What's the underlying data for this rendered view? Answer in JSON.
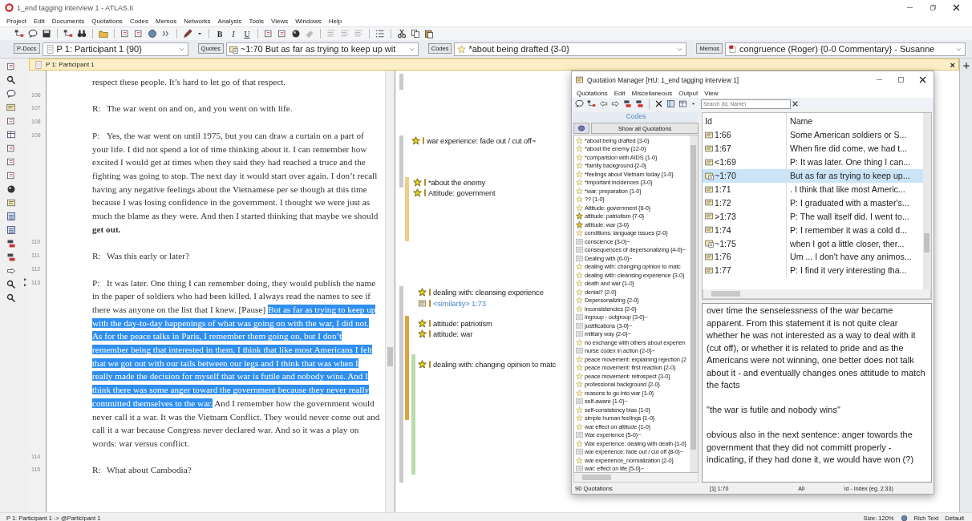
{
  "window": {
    "title": "1_end tagging interview 1 - ATLAS.ti"
  },
  "menu": [
    "Project",
    "Edit",
    "Documents",
    "Quotations",
    "Codes",
    "Memos",
    "Networks",
    "Analysis",
    "Tools",
    "Views",
    "Windows",
    "Help"
  ],
  "format_buttons": [
    "B",
    "I",
    "U"
  ],
  "selectors": [
    {
      "button": "P-Docs",
      "value": "P 1: Participant 1 {90}",
      "kind": "doc"
    },
    {
      "button": "Quotes",
      "value": "~1:70 But as far as trying to keep up wit",
      "kind": "quote"
    },
    {
      "button": "Codes",
      "value": "*about being drafted {3-0}",
      "kind": "code"
    },
    {
      "button": "Memos",
      "value": "congruence (Roger) {0-0 Commentary} - Susanne",
      "kind": "memo"
    }
  ],
  "document": {
    "title": "P 1: Participant 1",
    "close_label": "×",
    "paragraphs": [
      {
        "segments": [
          {
            "text": "respect these people. It’s hard to let go of that respect.",
            "selected": false
          }
        ]
      },
      {
        "number": "106"
      },
      {
        "number": "107",
        "speaker": "R:",
        "segments": [
          {
            "text": "The war went on and on, and you went on with life.",
            "selected": false
          }
        ]
      },
      {
        "number": "108"
      },
      {
        "number": "109",
        "speaker": "P:",
        "segments": [
          {
            "text": "Yes, the war went on until 1975, but you can draw a curtain on a part of your life. I did not spend a lot of time thinking about it. I can remember how excited I would get at times when they said they had reached a truce and the fighting was going to stop. The next day it would start over again. I don’t recall having any negative feelings about the Vietnamese per se though at this time because I was losing confidence in the government. I thought we were just as much the blame as they were. And then I started thinking that maybe we should **get out.**",
            "selected": false
          }
        ]
      },
      {
        "number": "110"
      },
      {
        "number": "111",
        "speaker": "R:",
        "segments": [
          {
            "text": "Was this early or later?",
            "selected": false
          }
        ]
      },
      {
        "number": "112"
      },
      {
        "number": "113",
        "speaker": "P:",
        "segments": [
          {
            "text": "It was later. One thing I can remember doing, they would publish the name in the paper of soldiers who had been killed. I always read the names to see if there was anyone on the list that I knew. [Pause] ",
            "selected": false
          },
          {
            "text": "But as far as trying to keep up with the day-to-day happenings of what was going on with the war, I did not. As for the peace talks in Paris, I remember them going on, but I don’t remember being that interested in them. I think that like most Americans I felt that we got out with our tails between our legs and I think that was when I really made the decision for myself that war is futile and nobody wins. And I think there was some anger toward the government because they never really committed themselves to the war.",
            "selected": true
          },
          {
            "text": " And I remember how the government would never call it a war. It was the Vietnam Conflict. They would never come out and call it a war because Congress never declared war. And so it was a play on words: war versus conflict.",
            "selected": false
          }
        ]
      },
      {
        "number": "114"
      },
      {
        "number": "115",
        "speaker": "R:",
        "segments": [
          {
            "text": "What about Cambodia?",
            "selected": false
          }
        ]
      }
    ]
  },
  "margin": {
    "bars": [
      {
        "color": "#c9c9ce"
      },
      {
        "color": "#c9c9ce"
      },
      {
        "color": "#f0cc88"
      },
      {
        "color": "#c9c9ce"
      },
      {
        "color": "#d9a441"
      },
      {
        "color": "#b9dcaa"
      }
    ],
    "codes": [
      {
        "label": "war experience: fade out / cut off~",
        "kind": "code"
      },
      {
        "label": "*about the enemy",
        "kind": "code"
      },
      {
        "label": "Attitude: government",
        "kind": "code"
      },
      {
        "label": "dealing with: cleansing experience",
        "kind": "code"
      },
      {
        "label": "<similartiy> 1:73",
        "kind": "link"
      },
      {
        "label": "attitude: patriotism",
        "kind": "code"
      },
      {
        "label": "attitude: war",
        "kind": "code"
      },
      {
        "label": "dealing with: changing opinion to matc",
        "kind": "code"
      }
    ]
  },
  "quotation_manager": {
    "title": "Quotation Manager [HU: 1_end tagging interview 1]",
    "menu": [
      "Quotations",
      "Edit",
      "Miscellaneous",
      "Output",
      "View"
    ],
    "search": {
      "placeholder": "Search (Id, Name)"
    },
    "codes_header": "Codes",
    "show_all_button": "Show all Quotations",
    "codes": [
      {
        "label": "*about being drafted {3-0}",
        "kind": "plain",
        "highlighted": false
      },
      {
        "label": "*about the enemy {12-0}",
        "kind": "plain",
        "highlighted": false
      },
      {
        "label": "*comparision with AIDS {1-0}",
        "kind": "plain",
        "highlighted": false
      },
      {
        "label": "*family background {2-0}",
        "kind": "plain",
        "highlighted": false
      },
      {
        "label": "*feelings about Vietnam today {1-0}",
        "kind": "plain",
        "highlighted": false
      },
      {
        "label": "*important incidences {3-0}",
        "kind": "plain",
        "highlighted": false
      },
      {
        "label": "*war: preparation {1-0}",
        "kind": "plain",
        "highlighted": false
      },
      {
        "label": "?? {1-0}",
        "kind": "plain",
        "highlighted": false
      },
      {
        "label": "Attitude: government {6-0}",
        "kind": "plain",
        "highlighted": false
      },
      {
        "label": "attitude: patriotism {7-0}",
        "kind": "plain",
        "highlighted": true
      },
      {
        "label": "attitude: war {3-0}",
        "kind": "plain",
        "highlighted": true
      },
      {
        "label": "conditions: language issues {2-0}",
        "kind": "plain",
        "highlighted": false
      },
      {
        "label": "conscience {3-0}~",
        "kind": "commented",
        "highlighted": false
      },
      {
        "label": "consequences of depersonalizing {4-0}~",
        "kind": "commented",
        "highlighted": false
      },
      {
        "label": "Dealing with {6-0}~",
        "kind": "commented",
        "highlighted": false
      },
      {
        "label": "dealing with: changing opinion to matc",
        "kind": "plain",
        "highlighted": false
      },
      {
        "label": "dealing with: cleansing experience {3-0}",
        "kind": "plain",
        "highlighted": false
      },
      {
        "label": "death and war {1-0}",
        "kind": "plain",
        "highlighted": false
      },
      {
        "label": "denial? {2-0}",
        "kind": "plain",
        "highlighted": false
      },
      {
        "label": "Depersonalizing {2-0}",
        "kind": "plain",
        "highlighted": false
      },
      {
        "label": "inconsistencies {2-0}",
        "kind": "plain",
        "highlighted": false
      },
      {
        "label": "ingroup - outgroup {3-0}~",
        "kind": "commented",
        "highlighted": false
      },
      {
        "label": "justifications {3-0}~",
        "kind": "commented",
        "highlighted": false
      },
      {
        "label": "military way {2-0}~",
        "kind": "commented",
        "highlighted": false
      },
      {
        "label": "no exchange with others about experien",
        "kind": "plain",
        "highlighted": false
      },
      {
        "label": "nurse codex in action {2-0}~",
        "kind": "commented",
        "highlighted": false
      },
      {
        "label": "peace movement: explaining rejection {2",
        "kind": "plain",
        "highlighted": false
      },
      {
        "label": "peace movement: first reaction {2-0}",
        "kind": "plain",
        "highlighted": false
      },
      {
        "label": "peace movement: retrospect {3-0}",
        "kind": "plain",
        "highlighted": false
      },
      {
        "label": "professional background {2-0}",
        "kind": "plain",
        "highlighted": false
      },
      {
        "label": "reasons to go into war {1-0}",
        "kind": "plain",
        "highlighted": false
      },
      {
        "label": "self-aware {1-0}~",
        "kind": "commented",
        "highlighted": false
      },
      {
        "label": "self-consistency bias {1-0}",
        "kind": "plain",
        "highlighted": false
      },
      {
        "label": "simple human feelings {1-0}",
        "kind": "plain",
        "highlighted": false
      },
      {
        "label": "war effect on attitude {1-0}",
        "kind": "plain",
        "highlighted": false
      },
      {
        "label": "War experience {5-0}~",
        "kind": "commented",
        "highlighted": false
      },
      {
        "label": "War experience: dealing with death {1-0}",
        "kind": "plain",
        "highlighted": false
      },
      {
        "label": "war experience: fade out / cut off {8-0}~",
        "kind": "commented",
        "highlighted": false
      },
      {
        "label": "war experience_normalization {2-0}",
        "kind": "plain",
        "highlighted": false
      },
      {
        "label": "war: effect on life {5-0}~",
        "kind": "commented",
        "highlighted": false
      }
    ],
    "codes_footer": "90 Quotations",
    "table": {
      "columns": [
        "Id",
        "Name"
      ],
      "rows": [
        {
          "id": "1:66",
          "name": "Some American soldiers or S...",
          "kind": "plain",
          "selected": false
        },
        {
          "id": "1:67",
          "name": "When fire did come, we had t...",
          "kind": "plain",
          "selected": false
        },
        {
          "id": "<1:69",
          "name": "P: It was later. One thing I can...",
          "kind": "plain",
          "selected": false
        },
        {
          "id": "~1:70",
          "name": "But as far as trying to keep up...",
          "kind": "commented",
          "selected": true
        },
        {
          "id": "1:71",
          "name": ". I think that like most Americ...",
          "kind": "plain",
          "selected": false
        },
        {
          "id": "1:72",
          "name": "P: I graduated with a master's...",
          "kind": "plain",
          "selected": false
        },
        {
          "id": ">1:73",
          "name": "P: The wall itself did. I went to...",
          "kind": "plain",
          "selected": false
        },
        {
          "id": "1:74",
          "name": "P: I remember it was a cold d...",
          "kind": "plain",
          "selected": false
        },
        {
          "id": "~1:75",
          "name": "when I got a little closer, ther...",
          "kind": "commented",
          "selected": false
        },
        {
          "id": "1:76",
          "name": "Um ... I don't have any animos...",
          "kind": "plain",
          "selected": false
        },
        {
          "id": "1:77",
          "name": "P: I find it very interesting tha...",
          "kind": "plain",
          "selected": false
        }
      ]
    },
    "comment": [
      "over time the senselessness of the war became apparent. From this statement it is not quite clear whether he was not interested as a way to deal with it (cut off), or whether it is related to pride and as the Americans were not winning, one better does not talk about it - and eventually changes ones attitude to match the facts",
      "\"the war is futile and nobody wins\"",
      "obvious also in the next sentence: anger towards the government that they did not committ properly - indicating, if they had done it, we would have won (?)"
    ],
    "status": [
      "[1] 1:70",
      "All",
      "Id - Index (eg. 2:33)"
    ]
  },
  "status_bar": {
    "left": "P 1: Participant 1 -> @Participant 1",
    "size": "Size: 120%",
    "format": "Rich Text",
    "style": "Default"
  }
}
